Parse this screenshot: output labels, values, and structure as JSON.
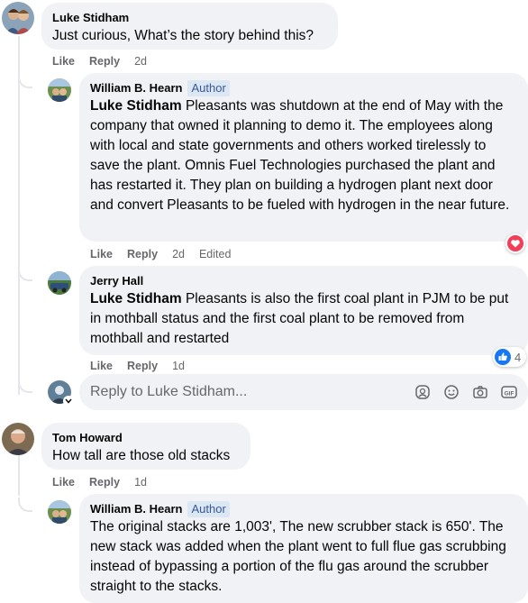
{
  "comments": [
    {
      "name": "Luke Stidham",
      "text": "Just curious, What’s the story behind this?",
      "like": "Like",
      "reply": "Reply",
      "time": "2d"
    },
    {
      "name": "William B. Hearn",
      "badge": "Author",
      "mention": "Luke Stidham",
      "text": " Pleasants was shutdown at the end of May with the company that owned it planning to demo it. The employees along with local and state governments and others worked tirelessly to save the plant. Omnis Fuel Technologies purchased the plant and has restarted it. They plan on building a hydrogen plant next door and convert Pleasants to be fueled with hydrogen in the near future.",
      "like": "Like",
      "reply": "Reply",
      "time": "2d",
      "edited": "Edited",
      "reaction": "heart"
    },
    {
      "name": "Jerry Hall",
      "mention": "Luke Stidham",
      "text": " Pleasants is also the first coal plant in PJM to be put in mothball status and the first coal plant to be removed from mothball and restarted",
      "like": "Like",
      "reply": "Reply",
      "time": "1d",
      "reaction": "like",
      "reaction_count": "4"
    },
    {
      "name": "Tom Howard",
      "text": "How tall are those old stacks",
      "like": "Like",
      "reply": "Reply",
      "time": "1d"
    },
    {
      "name": "William B. Hearn",
      "badge": "Author",
      "text": "The original stacks are 1,003', The new scrubber stack is 650'. The new stack was added when the plant went to full flue gas scrubbing instead of bypassing a portion of the flu gas around the scrubber straight to the stacks."
    }
  ],
  "reply_box": {
    "placeholder": "Reply to Luke Stidham..."
  },
  "colors": {
    "bubble": "#f0f2f5",
    "author_badge_bg": "#dbe7f2",
    "author_badge_text": "#385898",
    "meta_text": "#65676b",
    "heart": "#f33e58",
    "like_blue": "#1877f2"
  }
}
